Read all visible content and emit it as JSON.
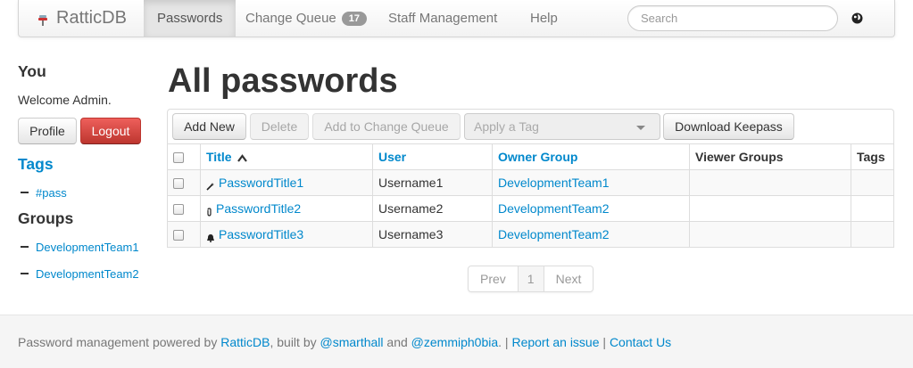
{
  "navbar": {
    "brand": "RatticDB",
    "items": [
      {
        "label": "Passwords",
        "active": true
      },
      {
        "label": "Change Queue",
        "badge": "17"
      },
      {
        "label": "Staff Management"
      },
      {
        "label": "Help"
      }
    ],
    "search_placeholder": "Search",
    "globe_icon": "globe-icon"
  },
  "sidebar": {
    "you_heading": "You",
    "welcome": "Welcome Admin.",
    "profile_label": "Profile",
    "logout_label": "Logout",
    "tags_heading": "Tags",
    "tags": [
      "#pass"
    ],
    "groups_heading": "Groups",
    "groups": [
      "DevelopmentTeam1",
      "DevelopmentTeam2"
    ]
  },
  "main": {
    "title": "All passwords",
    "toolbar": {
      "add_new": "Add New",
      "delete": "Delete",
      "add_to_queue": "Add to Change Queue",
      "apply_tag": "Apply a Tag",
      "download": "Download Keepass"
    },
    "table": {
      "headers": {
        "title": "Title",
        "user": "User",
        "owner_group": "Owner Group",
        "viewer_groups": "Viewer Groups",
        "tags": "Tags"
      },
      "rows": [
        {
          "icon": "wand-icon",
          "title": "PasswordTitle1",
          "user": "Username1",
          "owner_group": "DevelopmentTeam1",
          "viewer_groups": "",
          "tags": ""
        },
        {
          "icon": "clip-icon",
          "title": "PasswordTitle2",
          "user": "Username2",
          "owner_group": "DevelopmentTeam2",
          "viewer_groups": "",
          "tags": ""
        },
        {
          "icon": "bell-icon",
          "title": "PasswordTitle3",
          "user": "Username3",
          "owner_group": "DevelopmentTeam2",
          "viewer_groups": "",
          "tags": ""
        }
      ]
    },
    "pagination": {
      "prev": "Prev",
      "current": "1",
      "next": "Next"
    }
  },
  "footer": {
    "text1": "Password management powered by ",
    "ratticdb": "RatticDB",
    "text2": ", built by ",
    "author1": "@smarthall",
    "text3": " and ",
    "author2": "@zemmiph0bia",
    "text4": ". | ",
    "report": "Report an issue",
    "sep": " | ",
    "contact": "Contact Us"
  },
  "colors": {
    "link": "#0088cc",
    "danger": "#da4f49",
    "badge": "#999999"
  }
}
